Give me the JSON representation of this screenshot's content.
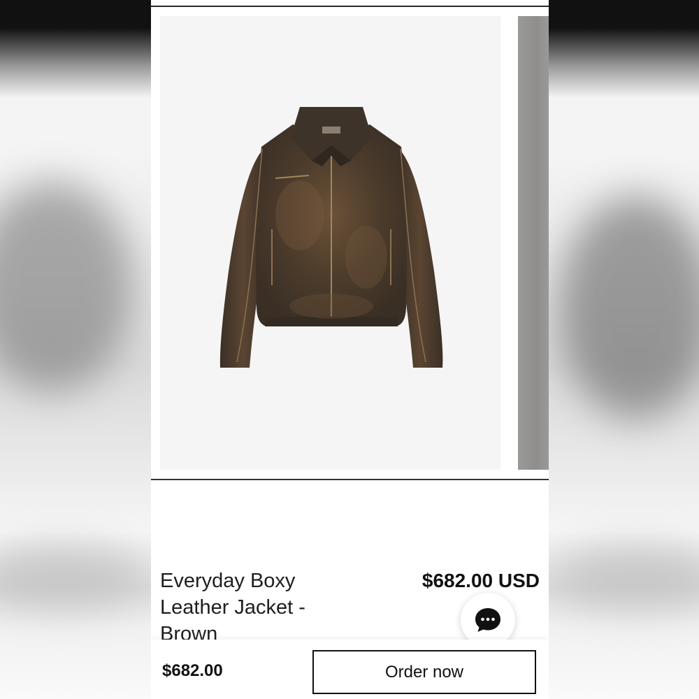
{
  "product": {
    "title": "Everyday Boxy Leather Jacket - Brown",
    "price": "$682.00 USD",
    "image": "leather-jacket-photo"
  },
  "purchase_bar": {
    "price": "$682.00",
    "order_label": "Order now"
  },
  "chat": {
    "icon": "chat-bubble-icon"
  },
  "colors": {
    "jacket_brown": "#4a3a2a",
    "button_border": "#111111",
    "image_background": "#f5f5f5"
  }
}
